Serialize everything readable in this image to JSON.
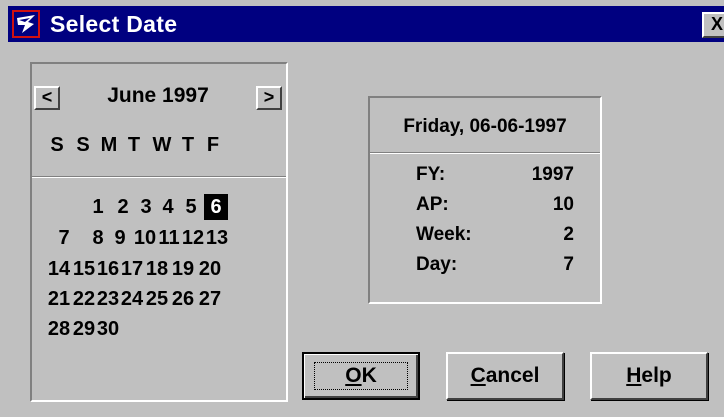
{
  "window": {
    "title": "Select Date",
    "close_label": "X",
    "colors": {
      "titlebar": "#000080",
      "face": "#c0c0c0",
      "selected_day": "#000000"
    }
  },
  "calendar": {
    "month_label": "June 1997",
    "prev_label": "<",
    "next_label": ">",
    "weekdays": [
      "S",
      "S",
      "M",
      "T",
      "W",
      "T",
      "F"
    ],
    "days": [
      "1",
      "2",
      "3",
      "4",
      "5",
      "6",
      "7",
      "8",
      "9",
      "10",
      "11",
      "12",
      "13",
      "14",
      "15",
      "16",
      "17",
      "18",
      "19",
      "20",
      "21",
      "22",
      "23",
      "24",
      "25",
      "26",
      "27",
      "28",
      "29",
      "30"
    ],
    "selected_day": "6"
  },
  "info": {
    "date_label": "Friday, 06-06-1997",
    "rows": [
      {
        "label": "FY:",
        "value": "1997"
      },
      {
        "label": "AP:",
        "value": "10"
      },
      {
        "label": "Week:",
        "value": "2"
      },
      {
        "label": "Day:",
        "value": "7"
      }
    ]
  },
  "buttons": {
    "ok": {
      "mnemonic": "O",
      "rest": "K"
    },
    "cancel": {
      "mnemonic": "C",
      "rest": "ancel"
    },
    "help": {
      "mnemonic": "H",
      "rest": "elp"
    }
  }
}
